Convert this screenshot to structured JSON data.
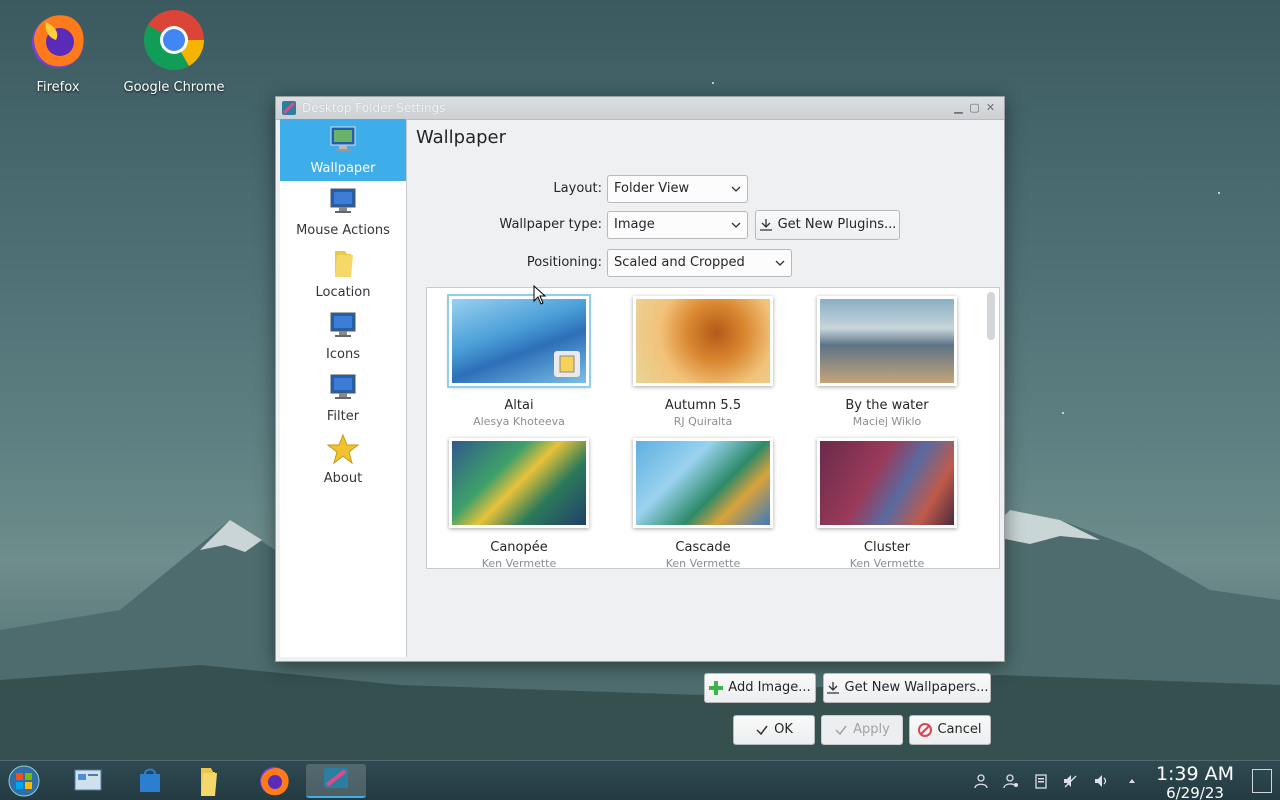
{
  "desktop": {
    "icons": [
      {
        "label": "Firefox",
        "icon": "firefox-icon"
      },
      {
        "label": "Google Chrome",
        "icon": "chrome-icon"
      }
    ]
  },
  "dialog": {
    "title": "Desktop Folder Settings",
    "sidebar": [
      {
        "label": "Wallpaper",
        "icon": "wallpaper-monitor-icon",
        "active": true
      },
      {
        "label": "Mouse Actions",
        "icon": "mouse-actions-monitor-icon",
        "active": false
      },
      {
        "label": "Location",
        "icon": "folder-icon",
        "active": false
      },
      {
        "label": "Icons",
        "icon": "icons-monitor-icon",
        "active": false
      },
      {
        "label": "Filter",
        "icon": "filter-monitor-icon",
        "active": false
      },
      {
        "label": "About",
        "icon": "star-icon",
        "active": false
      }
    ],
    "page_title": "Wallpaper",
    "form": {
      "layout_label": "Layout:",
      "layout_value": "Folder View",
      "wallpaper_type_label": "Wallpaper type:",
      "wallpaper_type_value": "Image",
      "get_plugins_label": "Get New Plugins...",
      "positioning_label": "Positioning:",
      "positioning_value": "Scaled and Cropped"
    },
    "wallpapers": [
      {
        "name": "Altai",
        "author": "Alesya Khoteeva",
        "selected": true
      },
      {
        "name": "Autumn 5.5",
        "author": "RJ Quiralta",
        "selected": false
      },
      {
        "name": "By the water",
        "author": "Maciej Wiklo",
        "selected": false
      },
      {
        "name": "Canopée",
        "author": "Ken Vermette",
        "selected": false
      },
      {
        "name": "Cascade",
        "author": "Ken Vermette",
        "selected": false
      },
      {
        "name": "Cluster",
        "author": "Ken Vermette",
        "selected": false
      }
    ],
    "buttons": {
      "add_image": "Add Image...",
      "get_wallpapers": "Get New Wallpapers...",
      "ok": "OK",
      "apply": "Apply",
      "cancel": "Cancel"
    }
  },
  "taskbar": {
    "clock_time": "1:39 AM",
    "clock_date": "6/29/23"
  },
  "colors": {
    "accent": "#3daee9",
    "window_bg": "#eff0f1"
  }
}
